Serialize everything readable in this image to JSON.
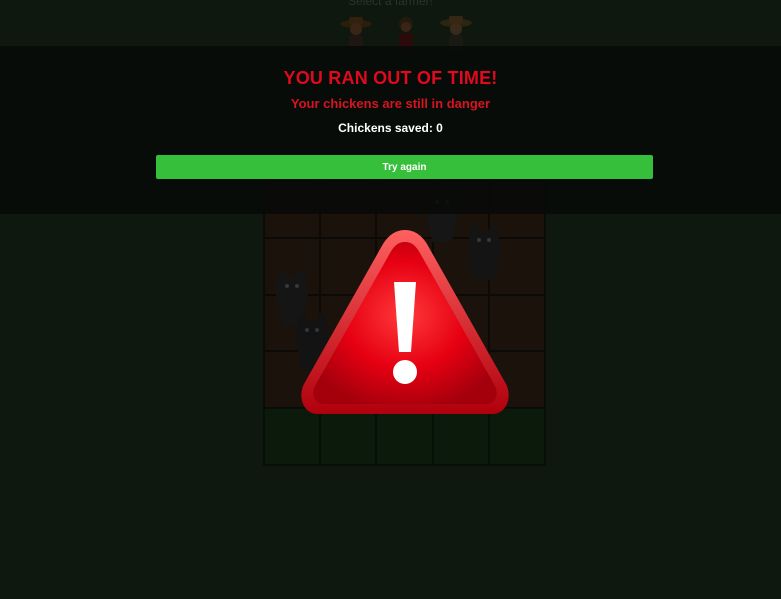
{
  "top_label": "Select a farmer!",
  "overlay": {
    "headline": "YOU RAN OUT OF TIME!",
    "subline": "Your chickens are still in danger",
    "saved_label": "Chickens saved: 0",
    "button_label": "Try again"
  },
  "icons": {
    "warning": "warning-triangle-icon",
    "farmer": "farmer-icon",
    "wolf": "wolf-icon"
  },
  "colors": {
    "headline": "#e0091d",
    "button": "#36bf3b",
    "warning_red": "#e60012"
  }
}
